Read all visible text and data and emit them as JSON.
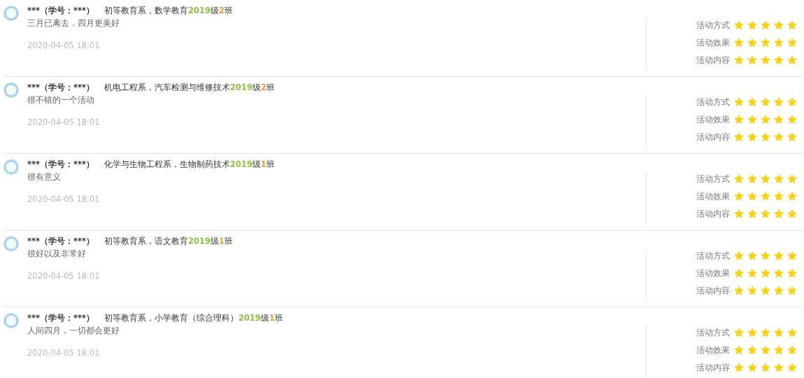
{
  "comments": [
    {
      "author": "***（学号：***）",
      "department": "初等教育系，数学教育",
      "year": "2019",
      "year_unit": "级",
      "class_no": "2",
      "class_unit": "班",
      "text": "三月已离去，四月更美好",
      "date": "2020-04-05 18:01",
      "ratings": [
        {
          "label": "活动方式",
          "stars": 5
        },
        {
          "label": "活动效果",
          "stars": 5
        },
        {
          "label": "活动内容",
          "stars": 5
        }
      ]
    },
    {
      "author": "***（学号：***）",
      "department": "机电工程系，汽车检测与维修技术",
      "year": "2019",
      "year_unit": "级",
      "class_no": "2",
      "class_unit": "班",
      "text": "很不错的一个活动",
      "date": "2020-04-05 18:01",
      "ratings": [
        {
          "label": "活动方式",
          "stars": 5
        },
        {
          "label": "活动效果",
          "stars": 5
        },
        {
          "label": "活动内容",
          "stars": 5
        }
      ]
    },
    {
      "author": "***（学号：***）",
      "department": "化学与生物工程系，生物制药技术",
      "year": "2019",
      "year_unit": "级",
      "class_no": "1",
      "class_unit": "班",
      "text": "很有意义",
      "date": "2020-04-05 18:01",
      "ratings": [
        {
          "label": "活动方式",
          "stars": 5
        },
        {
          "label": "活动效果",
          "stars": 5
        },
        {
          "label": "活动内容",
          "stars": 5
        }
      ]
    },
    {
      "author": "***（学号：***）",
      "department": "初等教育系，语文教育",
      "year": "2019",
      "year_unit": "级",
      "class_no": "1",
      "class_unit": "班",
      "text": "很好以及非常好",
      "date": "2020-04-05 18:01",
      "ratings": [
        {
          "label": "活动方式",
          "stars": 5
        },
        {
          "label": "活动效果",
          "stars": 5
        },
        {
          "label": "活动内容",
          "stars": 5
        }
      ]
    },
    {
      "author": "***（学号：***）",
      "department": "初等教育系，小学教育（综合理科）",
      "year": "2019",
      "year_unit": "级",
      "class_no": "1",
      "class_unit": "班",
      "text": "人间四月，一切都会更好",
      "date": "2020-04-05 18:01",
      "ratings": [
        {
          "label": "活动方式",
          "stars": 5
        },
        {
          "label": "活动效果",
          "stars": 5
        },
        {
          "label": "活动内容",
          "stars": 5
        }
      ]
    }
  ]
}
